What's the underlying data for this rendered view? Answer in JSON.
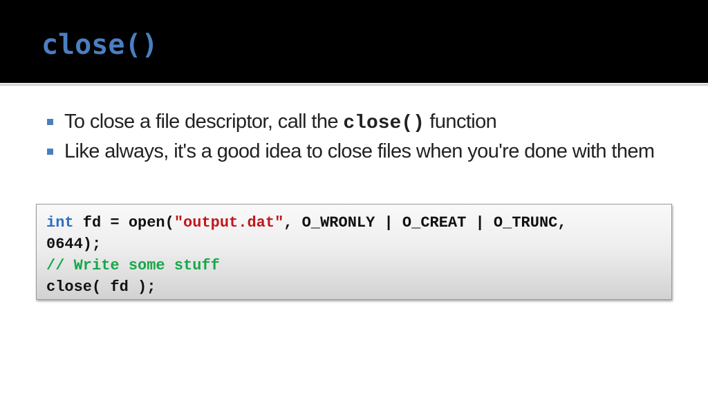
{
  "slide": {
    "title": "close()"
  },
  "bullets": [
    {
      "prefix": "To close a file descriptor, call the ",
      "code": "close()",
      "suffix": " function"
    },
    {
      "text": "Like always, it's a good idea to close files when you're done with them"
    }
  ],
  "code_block": {
    "line1": {
      "keyword": "int",
      "pre_string": " fd = open(",
      "string": "\"output.dat\"",
      "post_string": ", O_WRONLY | O_CREAT | O_TRUNC,"
    },
    "line2": "0644);",
    "line3_comment": "// Write some stuff",
    "line4": "close( fd );"
  },
  "colors": {
    "title": "#4a7fc1",
    "keyword": "#2e6fbf",
    "string": "#c0171b",
    "comment": "#17a84a",
    "bullet_marker": "#4a7fc1"
  }
}
